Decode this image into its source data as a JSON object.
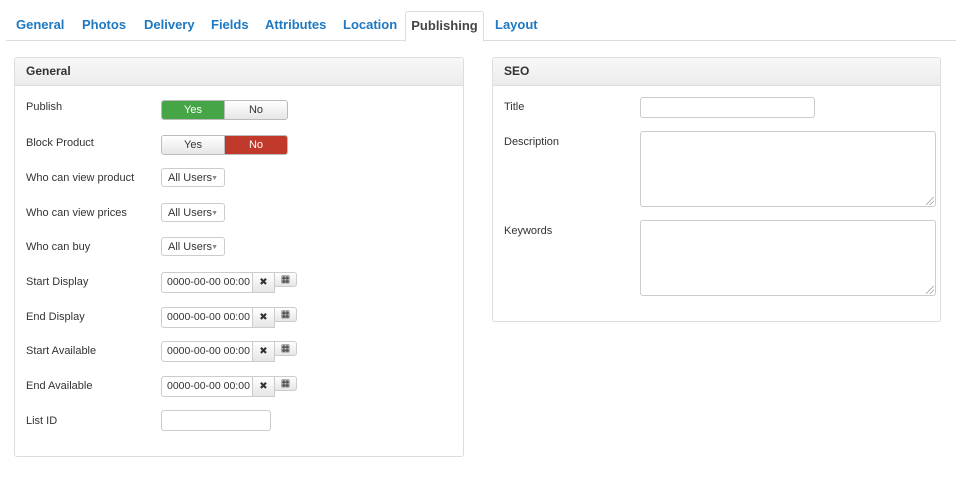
{
  "tabs": [
    {
      "label": "General",
      "active": false
    },
    {
      "label": "Photos",
      "active": false
    },
    {
      "label": "Delivery",
      "active": false
    },
    {
      "label": "Fields",
      "active": false
    },
    {
      "label": "Attributes",
      "active": false
    },
    {
      "label": "Location",
      "active": false
    },
    {
      "label": "Publishing",
      "active": true
    },
    {
      "label": "Layout",
      "active": false
    }
  ],
  "general": {
    "title": "General",
    "publish": {
      "label": "Publish",
      "yes": "Yes",
      "no": "No",
      "selected": "Yes"
    },
    "block_product": {
      "label": "Block Product",
      "yes": "Yes",
      "no": "No",
      "selected": "No"
    },
    "view_product": {
      "label": "Who can view product",
      "value": "All Users"
    },
    "view_prices": {
      "label": "Who can view prices",
      "value": "All Users"
    },
    "can_buy": {
      "label": "Who can buy",
      "value": "All Users"
    },
    "start_display": {
      "label": "Start Display",
      "value": "0000-00-00 00:00"
    },
    "end_display": {
      "label": "End Display",
      "value": "0000-00-00 00:00"
    },
    "start_available": {
      "label": "Start Available",
      "value": "0000-00-00 00:00"
    },
    "end_available": {
      "label": "End Available",
      "value": "0000-00-00 00:00"
    },
    "list_id": {
      "label": "List ID",
      "value": ""
    }
  },
  "seo": {
    "title": "SEO",
    "title_field": {
      "label": "Title",
      "value": ""
    },
    "description": {
      "label": "Description",
      "value": ""
    },
    "keywords": {
      "label": "Keywords",
      "value": ""
    }
  },
  "colors": {
    "link": "#1e78c2",
    "yes_active": "#46a546",
    "no_active": "#c0392b"
  },
  "icons": {
    "clear": "times-icon",
    "calendar": "calendar-icon",
    "dropdown": "caret-down-icon"
  }
}
